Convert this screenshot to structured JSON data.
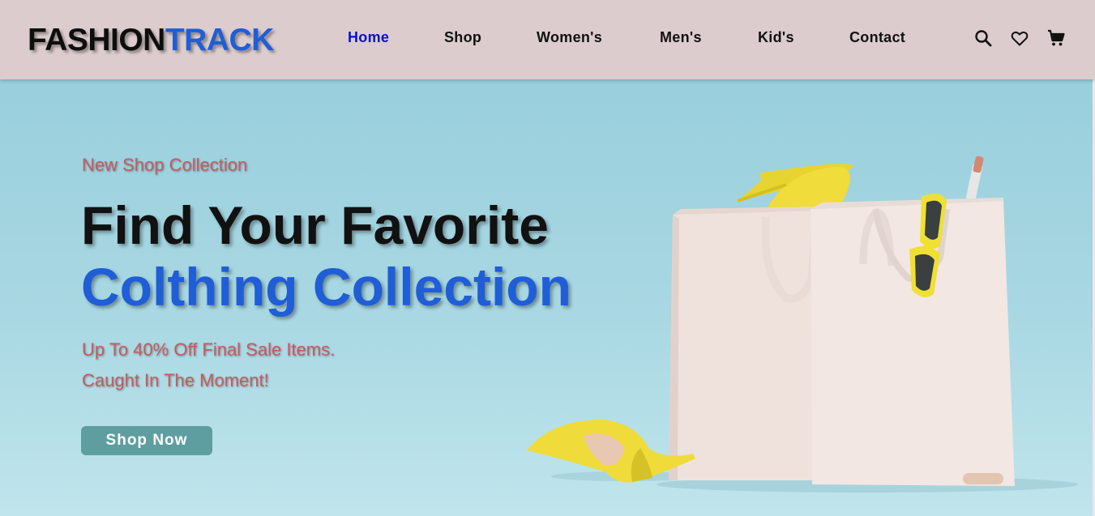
{
  "brand": {
    "part1": "FASHION",
    "part2": "TRACK"
  },
  "nav": {
    "items": [
      {
        "label": "Home",
        "active": true
      },
      {
        "label": "Shop"
      },
      {
        "label": "Women's"
      },
      {
        "label": "Men's"
      },
      {
        "label": "Kid's"
      },
      {
        "label": "Contact"
      }
    ],
    "icons": [
      "search-icon",
      "heart-icon",
      "cart-icon"
    ]
  },
  "hero": {
    "eyebrow": "New Shop Collection",
    "title_line1": "Find Your Favorite",
    "title_line2": "Colthing Collection",
    "subtitle_line1": "Up To 40% Off Final Sale Items.",
    "subtitle_line2": "Caught In The Moment!",
    "cta_label": "Shop Now"
  },
  "colors": {
    "nav_bg": "#dcccce",
    "active_link": "#0a12c8",
    "brand_accent": "#1f5ed6",
    "accent_text": "#c95a5f",
    "button_bg": "#5f9ea0",
    "hero_bg": "#a7d3df"
  }
}
